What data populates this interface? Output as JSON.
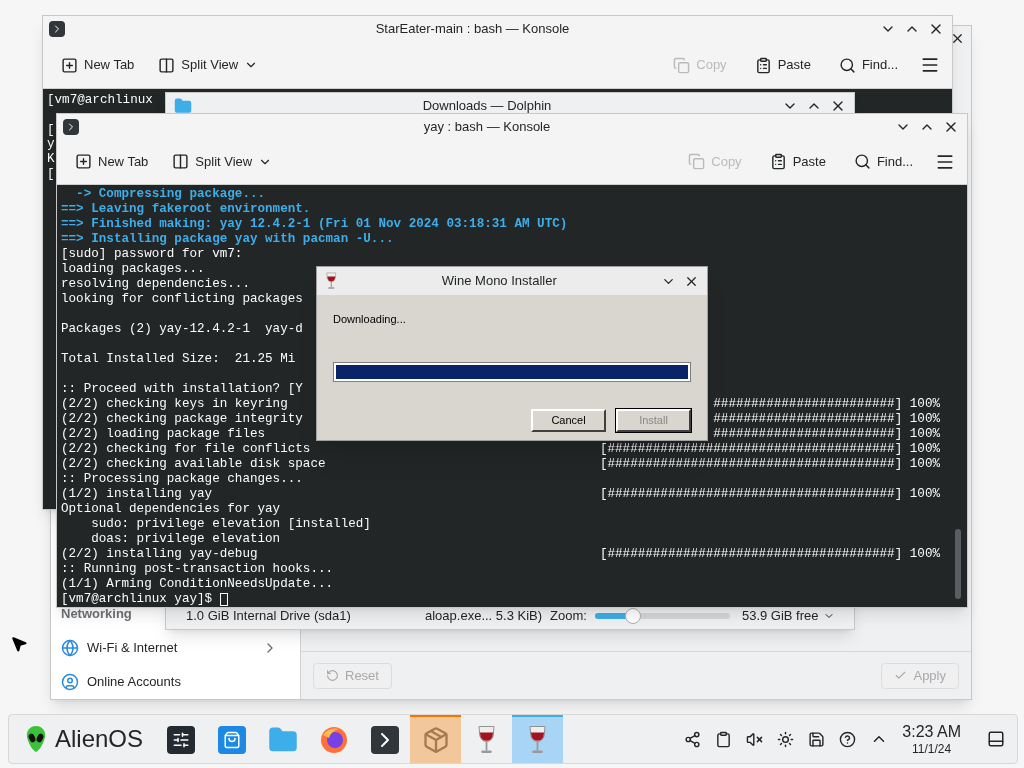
{
  "settings_window": {
    "sidebar": {
      "section": "Networking",
      "items": [
        {
          "label": "Wi-Fi & Internet",
          "kind": "globe",
          "has_children": true
        },
        {
          "label": "Online Accounts",
          "kind": "accounts",
          "has_children": false
        }
      ]
    },
    "buttons": [
      {
        "label": "Reset",
        "kind": "reset",
        "disabled": true
      },
      {
        "label": "Apply",
        "kind": "apply",
        "disabled": true
      }
    ]
  },
  "back_konsole": {
    "title": "StarEater-main : bash — Konsole",
    "toolbar": [
      {
        "label": "New Tab",
        "kind": "new-tab",
        "disabled": false
      },
      {
        "label": "Split View",
        "kind": "split",
        "disabled": false
      },
      {
        "label": "Copy",
        "kind": "copy",
        "disabled": true
      },
      {
        "label": "Paste",
        "kind": "paste",
        "disabled": false
      },
      {
        "label": "Find...",
        "kind": "find",
        "disabled": false
      }
    ],
    "lines": [
      {
        "kind": "plain",
        "text": "[vm7@archlinux"
      },
      {
        "kind": "blank"
      },
      {
        "kind": "plain",
        "text": "["
      },
      {
        "kind": "plain",
        "text": "y"
      },
      {
        "kind": "plain",
        "text": "K"
      },
      {
        "kind": "plain",
        "text": "["
      }
    ]
  },
  "dolphin_window": {
    "title": "Downloads — Dolphin",
    "status_bar": {
      "drive": "1.0 GiB Internal Drive (sda1)",
      "file_info": "aloap.exe... 5.3 KiB)",
      "zoom_label": "Zoom:",
      "zoom": {
        "level": 0.25
      },
      "free_space": "53.9 GiB free"
    }
  },
  "front_konsole": {
    "title": "yay : bash — Konsole",
    "toolbar": [
      {
        "label": "New Tab",
        "kind": "new-tab",
        "disabled": false
      },
      {
        "label": "Split View",
        "kind": "split",
        "disabled": false
      },
      {
        "label": "Copy",
        "kind": "copy",
        "disabled": true
      },
      {
        "label": "Paste",
        "kind": "paste",
        "disabled": false
      },
      {
        "label": "Find...",
        "kind": "find",
        "disabled": false
      }
    ],
    "lines": [
      {
        "kind": "status",
        "text": "  -> Compressing package..."
      },
      {
        "kind": "status",
        "text": "==> Leaving fakeroot environment."
      },
      {
        "kind": "status",
        "text": "==> Finished making: yay 12.4.2-1 (Fri 01 Nov 2024 03:18:31 AM UTC)"
      },
      {
        "kind": "status",
        "text": "==> Installing package yay with pacman -U..."
      },
      {
        "kind": "plain",
        "text": "[sudo] password for vm7:"
      },
      {
        "kind": "plain",
        "text": "loading packages..."
      },
      {
        "kind": "plain",
        "text": "resolving dependencies..."
      },
      {
        "kind": "plain",
        "text": "looking for conflicting packages"
      },
      {
        "kind": "blank"
      },
      {
        "kind": "plain",
        "text": "Packages (2) yay-12.4.2-1  yay-d"
      },
      {
        "kind": "blank"
      },
      {
        "kind": "plain",
        "text": "Total Installed Size:  21.25 Mi"
      },
      {
        "kind": "blank"
      },
      {
        "kind": "plain",
        "text": ":: Proceed with installation? [Y"
      },
      {
        "kind": "plain",
        "text": "(2/2) checking keys in keyring",
        "bar": "########################] 100%"
      },
      {
        "kind": "plain",
        "text": "(2/2) checking package integrity",
        "bar": "########################] 100%"
      },
      {
        "kind": "plain",
        "text": "(2/2) loading package files",
        "bar": "########################] 100%"
      },
      {
        "kind": "plain",
        "text": "(2/2) checking for file conflicts",
        "bar": "[######################################] 100%"
      },
      {
        "kind": "plain",
        "text": "(2/2) checking available disk space",
        "bar": "[######################################] 100%"
      },
      {
        "kind": "plain",
        "text": ":: Processing package changes..."
      },
      {
        "kind": "plain",
        "text": "(1/2) installing yay",
        "bar": "[######################################] 100%"
      },
      {
        "kind": "plain",
        "text": "Optional dependencies for yay"
      },
      {
        "kind": "plain",
        "text": "    sudo: privilege elevation [installed]"
      },
      {
        "kind": "plain",
        "text": "    doas: privilege elevation"
      },
      {
        "kind": "plain",
        "text": "(2/2) installing yay-debug",
        "bar": "[######################################] 100%"
      },
      {
        "kind": "plain",
        "text": ":: Running post-transaction hooks..."
      },
      {
        "kind": "plain",
        "text": "(1/1) Arming ConditionNeedsUpdate..."
      },
      {
        "kind": "prompt",
        "text": "[vm7@archlinux yay]$ "
      }
    ]
  },
  "installer_dialog": {
    "title": "Wine Mono Installer",
    "message": "Downloading...",
    "progress": {
      "level": 1
    },
    "buttons": [
      {
        "label": "Cancel",
        "disabled": false
      },
      {
        "label": "Install",
        "disabled": true
      }
    ]
  },
  "taskbar": {
    "launcher": {
      "label": "AlienOS"
    },
    "tasks": [
      {
        "kind": "settings",
        "selected": false,
        "attention": false
      },
      {
        "kind": "store",
        "selected": false,
        "attention": false
      },
      {
        "kind": "files",
        "selected": false,
        "attention": false
      },
      {
        "kind": "browser",
        "selected": false,
        "attention": false
      },
      {
        "kind": "terminal",
        "selected": false,
        "attention": false
      },
      {
        "kind": "package",
        "selected": false,
        "attention": true
      },
      {
        "kind": "wine",
        "selected": false,
        "attention": false
      },
      {
        "kind": "wine",
        "selected": true,
        "attention": false
      }
    ],
    "clock": {
      "time": "3:23 AM",
      "date": "11/1/24"
    }
  }
}
